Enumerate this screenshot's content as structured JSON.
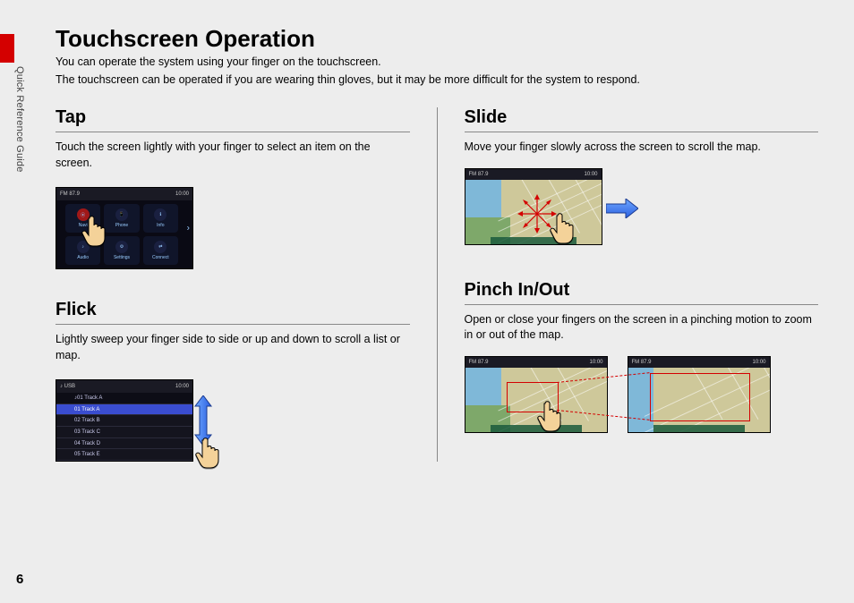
{
  "side_label": "Quick Reference Guide",
  "title": "Touchscreen Operation",
  "intro_line1": "You can operate the system using your finger on the touchscreen.",
  "intro_line2": "The touchscreen can be operated if you are wearing thin gloves, but it may be more difficult for the system to respond.",
  "page_number": "6",
  "clock": "10:00",
  "radio_label": "FM",
  "radio_freq": "87.9",
  "tap": {
    "title": "Tap",
    "body": "Touch the screen lightly with your finger to select an item on the screen.",
    "icons": [
      "Navi",
      "Phone",
      "Info",
      "Audio",
      "Settings",
      "Connect"
    ]
  },
  "flick": {
    "title": "Flick",
    "body": "Lightly sweep your finger side to side or up and down to scroll a list or map.",
    "source": "USB",
    "header": "01  Track A",
    "tracks": [
      "01  Track A",
      "02  Track B",
      "03  Track C",
      "04  Track D",
      "05  Track E"
    ]
  },
  "slide": {
    "title": "Slide",
    "body": "Move your finger slowly across the screen to scroll the map."
  },
  "pinch": {
    "title": "Pinch In/Out",
    "body": "Open or close your fingers on the screen in a pinching motion to zoom in or out of the map."
  }
}
